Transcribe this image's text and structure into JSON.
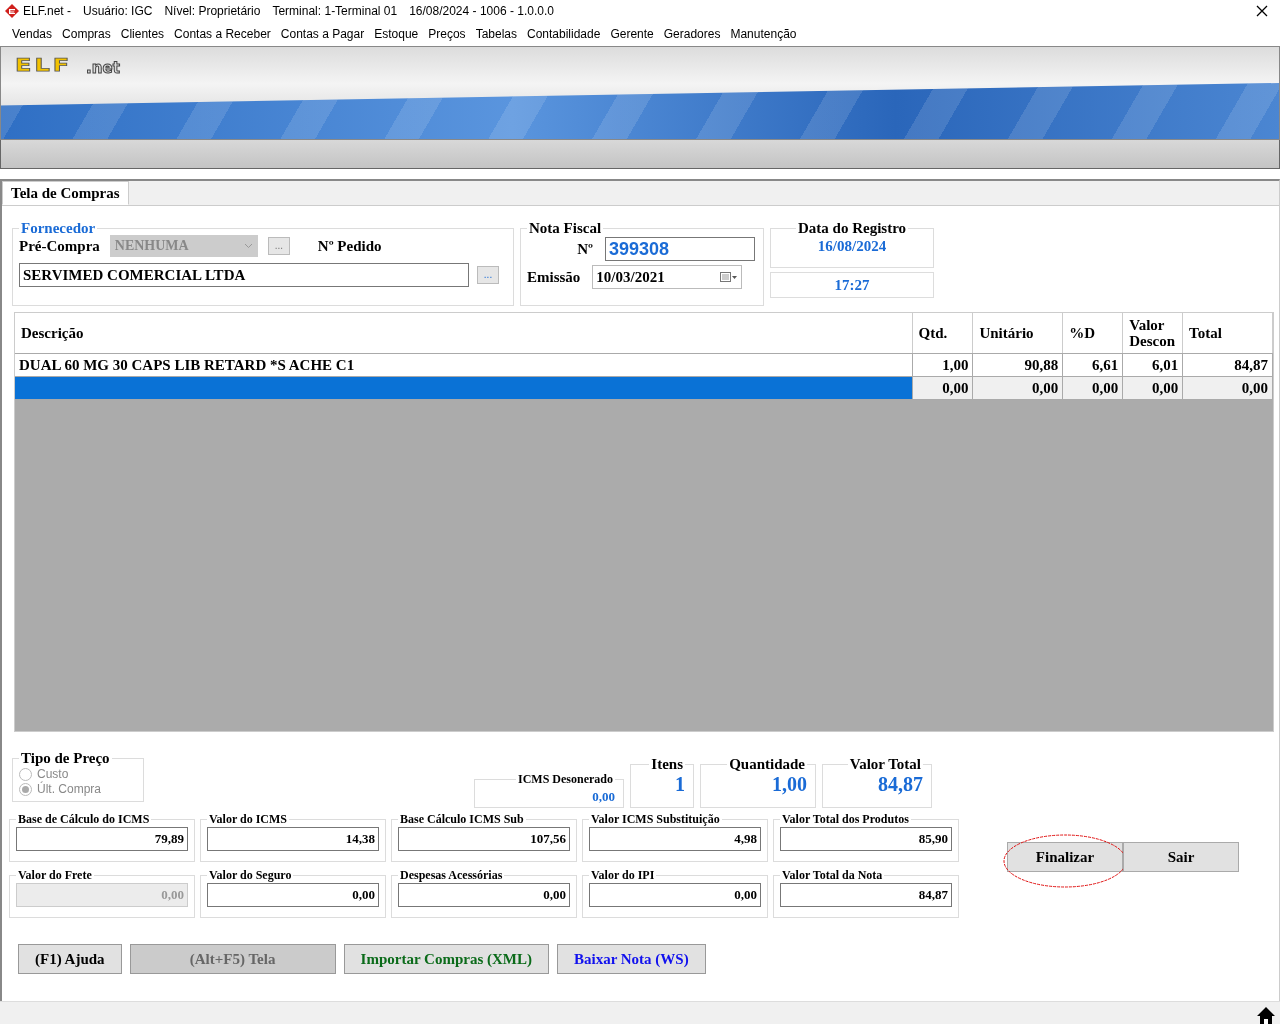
{
  "title_bar": {
    "app": "ELF.net -",
    "user": "Usuário: IGC",
    "level": "Nível: Proprietário",
    "terminal": "Terminal: 1-Terminal 01",
    "info": "16/08/2024 - 1006 - 1.0.0.0"
  },
  "menu": [
    "Vendas",
    "Compras",
    "Clientes",
    "Contas a Receber",
    "Contas a Pagar",
    "Estoque",
    "Preços",
    "Tabelas",
    "Contabilidade",
    "Gerente",
    "Geradores",
    "Manutenção"
  ],
  "logo": {
    "main": "ELF",
    "suffix": ".net"
  },
  "tabs": [
    {
      "label": "Tela de Compras",
      "selected": true
    }
  ],
  "fornecedor": {
    "legend": "Fornecedor",
    "pre_compra_label": "Pré-Compra",
    "pre_compra_value": "NENHUMA",
    "pre_compra_disabled": true,
    "pre_compra_browse": "...",
    "pedido_label": "Nº Pedido",
    "supplier": "SERVIMED COMERCIAL LTDA",
    "supplier_browse": "..."
  },
  "nota_fiscal": {
    "legend": "Nota Fiscal",
    "numero_label": "Nº",
    "numero": "399308",
    "emissao_label": "Emissão",
    "emissao": "10/03/2021"
  },
  "data_registro": {
    "legend": "Data do Registro",
    "date": "16/08/2024",
    "time": "17:27"
  },
  "table": {
    "columns": [
      "Descrição",
      "Qtd.",
      "Unitário",
      "%D",
      "Valor Descon",
      "Total"
    ],
    "rows": [
      {
        "cells": [
          "DUAL 60 MG 30 CAPS LIB RETARD *S ACHE C1",
          "1,00",
          "90,88",
          "6,61",
          "6,01",
          "84,87"
        ],
        "selected": false
      },
      {
        "cells": [
          "",
          "0,00",
          "0,00",
          "0,00",
          "0,00",
          "0,00"
        ],
        "selected": true
      }
    ]
  },
  "tipo_preco": {
    "legend": "Tipo de Preço",
    "disabled": true,
    "options": [
      {
        "label": "Custo",
        "selected": false
      },
      {
        "label": "Últ. Compra",
        "selected": true
      }
    ]
  },
  "icms_desonerado": {
    "label": "ICMS Desonerado",
    "value": "0,00"
  },
  "summary": [
    {
      "label": "Itens",
      "value": "1"
    },
    {
      "label": "Quantidade",
      "value": "1,00"
    },
    {
      "label": "Valor Total",
      "value": "84,87"
    }
  ],
  "fields": [
    {
      "label": "Base de Cálculo do ICMS",
      "value": "79,89",
      "disabled": false
    },
    {
      "label": "Valor do ICMS",
      "value": "14,38",
      "disabled": false
    },
    {
      "label": "Base Cálculo ICMS Sub",
      "value": "107,56",
      "disabled": false
    },
    {
      "label": "Valor ICMS Substituição",
      "value": "4,98",
      "disabled": false
    },
    {
      "label": "Valor Total dos Produtos",
      "value": "85,90",
      "disabled": false
    },
    {
      "label": "Valor do Frete",
      "value": "0,00",
      "disabled": true
    },
    {
      "label": "Valor do Seguro",
      "value": "0,00",
      "disabled": false
    },
    {
      "label": "Despesas Acessórias",
      "value": "0,00",
      "disabled": false
    },
    {
      "label": "Valor do IPI",
      "value": "0,00",
      "disabled": false
    },
    {
      "label": "Valor Total da Nota",
      "value": "84,87",
      "disabled": false
    }
  ],
  "actions": [
    {
      "label": "Finalizar",
      "circled": true
    },
    {
      "label": "Sair",
      "circled": false
    }
  ],
  "bottom_buttons": [
    {
      "label": "(F1) Ajuda",
      "kind": "normal"
    },
    {
      "label": "(Alt+F5) Tela",
      "kind": "disabled"
    },
    {
      "label": "Importar Compras (XML)",
      "kind": "green"
    },
    {
      "label": "Baixar Nota (WS)",
      "kind": "blue"
    }
  ]
}
